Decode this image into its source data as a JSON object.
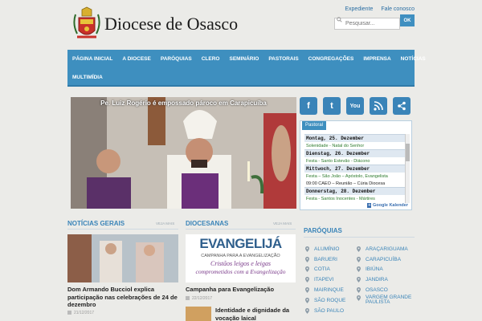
{
  "site": {
    "title": "Diocese de Osasco"
  },
  "toplinks": [
    "Expediente",
    "Fale conosco"
  ],
  "search": {
    "placeholder": "Pesquisar...",
    "button": "OK"
  },
  "nav": {
    "row1": [
      "PÁGINA INICIAL",
      "A DIOCESE",
      "PARÓQUIAS",
      "CLERO",
      "SEMINÁRIO",
      "PASTORAIS",
      "CONGREGAÇÕES",
      "IMPRENSA",
      "NOTÍCIAS"
    ],
    "row2": [
      "MULTIMÍDIA"
    ]
  },
  "slider": {
    "caption": "Pe. Luiz Rogério é empossado pároco em Carapicuíba"
  },
  "social": [
    "facebook-icon",
    "twitter-icon",
    "youtube-icon",
    "rss-icon",
    "share-icon"
  ],
  "calendar": {
    "tab": "Pastoral",
    "days": [
      {
        "day": "Montag, 25. Dezember",
        "events": [
          {
            "text": "Solenidade - Natal do Senhor",
            "style": ""
          }
        ]
      },
      {
        "day": "Dienstag, 26. Dezember",
        "events": [
          {
            "text": "Festa - Santo Estevão - Diácono",
            "style": ""
          }
        ]
      },
      {
        "day": "Mittwoch, 27. Dezember",
        "events": [
          {
            "text": "Festa – São João – Apóstolo, Evangelista",
            "style": ""
          },
          {
            "text": "09:00        CAEO – Reunião – Cúria Diocesa",
            "style": "dark"
          }
        ]
      },
      {
        "day": "Donnerstag, 28. Dezember",
        "events": [
          {
            "text": "Festa - Santos Inocentes - Mártires",
            "style": ""
          }
        ]
      }
    ],
    "google_label": "Google Kalender"
  },
  "news": {
    "title": "NOTÍCIAS GERAIS",
    "more": "VEJA MAIS",
    "item_title": "Dom Armando Bucciol explica participação nas celebrações de 24 de dezembro",
    "item_date": "21/12/2017"
  },
  "diocesanas": {
    "title": "DIOCESANAS",
    "more": "VEJA MAIS",
    "banner_title": "EVANGELIJÁ",
    "banner_sub": "CAMPANHA PARA A EVANGELIZAÇÃO",
    "banner_script1": "Cristãos leigos e leigas",
    "banner_script2": "comprometidos com a Evangelização",
    "item_title": "Campanha para Evangelização",
    "item_date": "22/12/2017",
    "item2_title": "Identidade e dignidade da vocação laical"
  },
  "paroquias": {
    "title": "PARÓQUIAS",
    "left": [
      "ALUMÍNIO",
      "BARUERI",
      "COTIA",
      "ITAPEVI",
      "MAIRINQUE",
      "SÃO ROQUE",
      "SÃO PAULO"
    ],
    "right": [
      "ARAÇARIGUAMA",
      "CARAPICUÍBA",
      "IBIÚNA",
      "JANDIRA",
      "OSASCO",
      "VARGEM GRANDE PAULISTA"
    ]
  },
  "colors": {
    "accent": "#3e8fbf",
    "link": "#3a84b8",
    "background": "#ebebe8"
  }
}
